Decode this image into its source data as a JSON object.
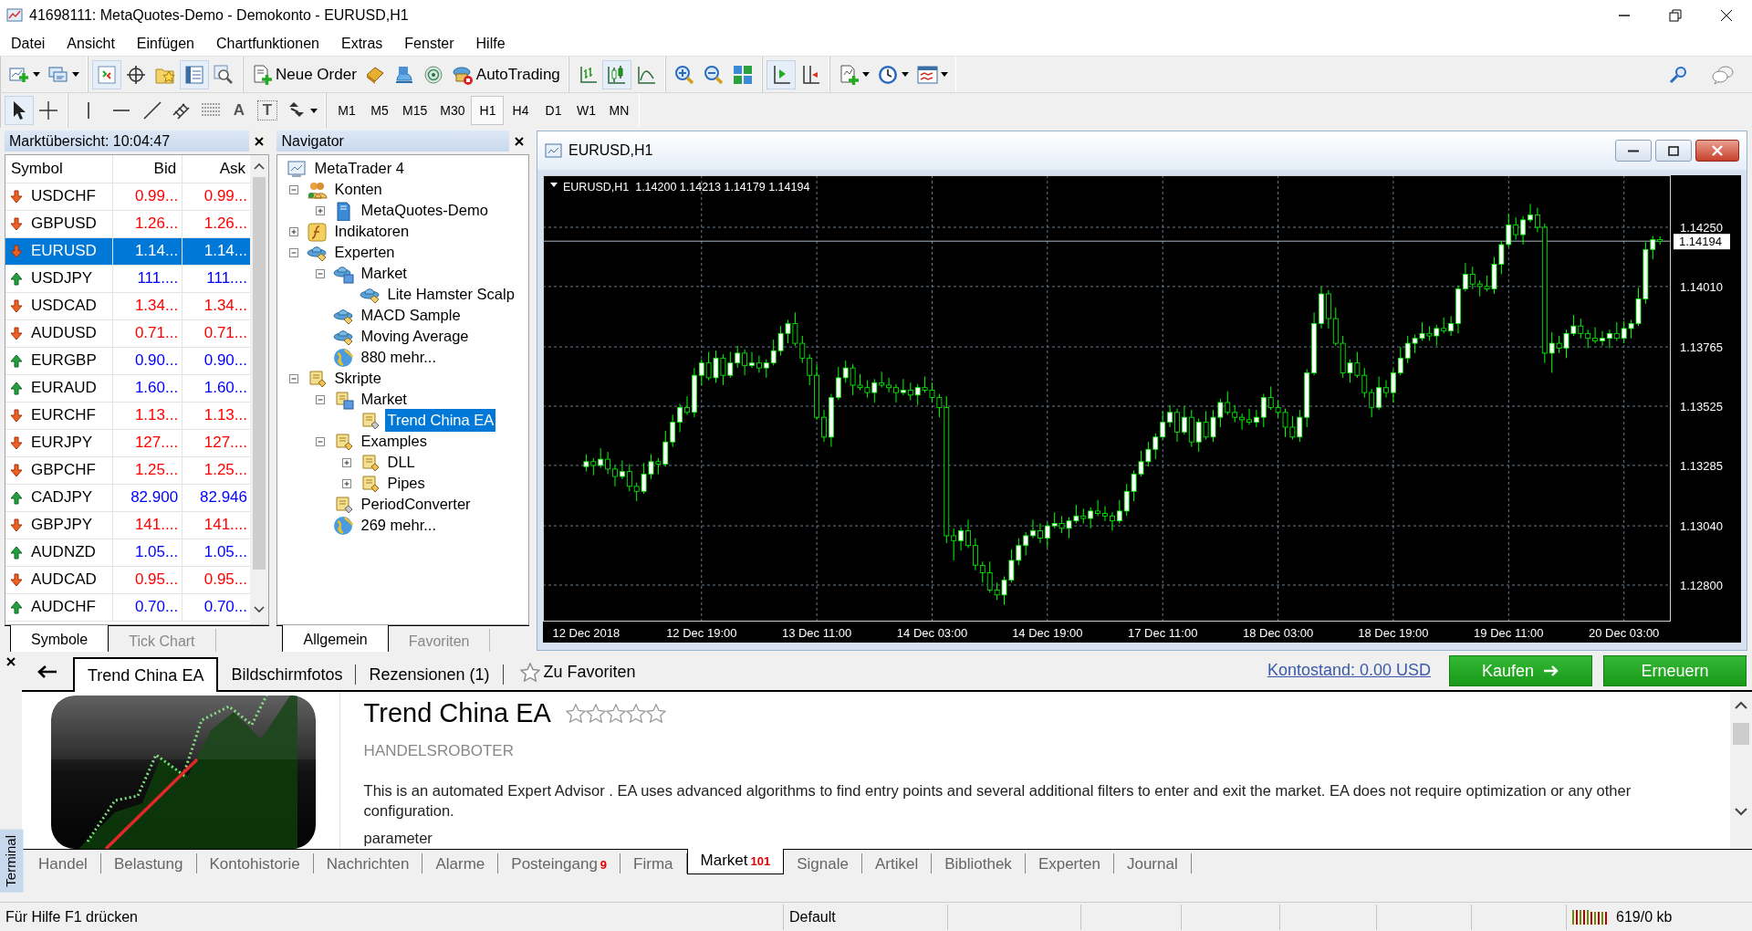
{
  "window": {
    "title": "41698111: MetaQuotes-Demo - Demokonto - EURUSD,H1"
  },
  "menu": [
    "Datei",
    "Ansicht",
    "Einfügen",
    "Chartfunktionen",
    "Extras",
    "Fenster",
    "Hilfe"
  ],
  "toolbar": {
    "new_order": "Neue Order",
    "autotrading": "AutoTrading",
    "text_tool": "A",
    "label_tool": "T"
  },
  "timeframes": [
    {
      "label": "M1",
      "selected": false
    },
    {
      "label": "M5",
      "selected": false
    },
    {
      "label": "M15",
      "selected": false
    },
    {
      "label": "M30",
      "selected": false
    },
    {
      "label": "H1",
      "selected": true
    },
    {
      "label": "H4",
      "selected": false
    },
    {
      "label": "D1",
      "selected": false
    },
    {
      "label": "W1",
      "selected": false
    },
    {
      "label": "MN",
      "selected": false
    }
  ],
  "market_watch": {
    "title": "Marktübersicht: 10:04:47",
    "columns": [
      "Symbol",
      "Bid",
      "Ask"
    ],
    "rows": [
      {
        "symbol": "USDCHF",
        "bid": "0.99...",
        "ask": "0.99...",
        "kind": "down",
        "selected": false
      },
      {
        "symbol": "GBPUSD",
        "bid": "1.26...",
        "ask": "1.26...",
        "kind": "down",
        "selected": false
      },
      {
        "symbol": "EURUSD",
        "bid": "1.14...",
        "ask": "1.14...",
        "kind": "down",
        "selected": true
      },
      {
        "symbol": "USDJPY",
        "bid": "111....",
        "ask": "111....",
        "kind": "up",
        "selected": false
      },
      {
        "symbol": "USDCAD",
        "bid": "1.34...",
        "ask": "1.34...",
        "kind": "down",
        "selected": false
      },
      {
        "symbol": "AUDUSD",
        "bid": "0.71...",
        "ask": "0.71...",
        "kind": "down",
        "selected": false
      },
      {
        "symbol": "EURGBP",
        "bid": "0.90...",
        "ask": "0.90...",
        "kind": "up",
        "selected": false
      },
      {
        "symbol": "EURAUD",
        "bid": "1.60...",
        "ask": "1.60...",
        "kind": "up",
        "selected": false
      },
      {
        "symbol": "EURCHF",
        "bid": "1.13...",
        "ask": "1.13...",
        "kind": "down",
        "selected": false
      },
      {
        "symbol": "EURJPY",
        "bid": "127....",
        "ask": "127....",
        "kind": "down",
        "selected": false
      },
      {
        "symbol": "GBPCHF",
        "bid": "1.25...",
        "ask": "1.25...",
        "kind": "down",
        "selected": false
      },
      {
        "symbol": "CADJPY",
        "bid": "82.900",
        "ask": "82.946",
        "kind": "up",
        "selected": false
      },
      {
        "symbol": "GBPJPY",
        "bid": "141....",
        "ask": "141....",
        "kind": "down",
        "selected": false
      },
      {
        "symbol": "AUDNZD",
        "bid": "1.05...",
        "ask": "1.05...",
        "kind": "up",
        "selected": false
      },
      {
        "symbol": "AUDCAD",
        "bid": "0.95...",
        "ask": "0.95...",
        "kind": "down",
        "selected": false
      },
      {
        "symbol": "AUDCHF",
        "bid": "0.70...",
        "ask": "0.70...",
        "kind": "up",
        "selected": false
      }
    ],
    "tabs": [
      {
        "label": "Symbole",
        "selected": true
      },
      {
        "label": "Tick Chart",
        "selected": false
      }
    ]
  },
  "navigator": {
    "title": "Navigator",
    "tree": [
      {
        "label": "MetaTrader 4",
        "kind": "root",
        "selected": false,
        "children": [
          {
            "label": "Konten",
            "kind": "accounts",
            "expanded": true,
            "selected": false,
            "children": [
              {
                "label": "MetaQuotes-Demo",
                "kind": "server",
                "expanded": false,
                "selected": false
              }
            ]
          },
          {
            "label": "Indikatoren",
            "kind": "indicators",
            "expanded": false,
            "selected": false
          },
          {
            "label": "Experten",
            "kind": "experts",
            "expanded": true,
            "selected": false,
            "children": [
              {
                "label": "Market",
                "kind": "market-experts",
                "expanded": true,
                "selected": false,
                "children": [
                  {
                    "label": "Lite Hamster Scalp",
                    "kind": "expert",
                    "selected": false
                  }
                ]
              },
              {
                "label": "MACD Sample",
                "kind": "expert",
                "selected": false
              },
              {
                "label": "Moving Average",
                "kind": "expert",
                "selected": false
              },
              {
                "label": "880 mehr...",
                "kind": "more",
                "selected": false
              }
            ]
          },
          {
            "label": "Skripte",
            "kind": "scripts",
            "expanded": true,
            "selected": false,
            "children": [
              {
                "label": "Market",
                "kind": "market-scripts",
                "expanded": true,
                "selected": false,
                "children": [
                  {
                    "label": "Trend China EA",
                    "kind": "script",
                    "selected": true
                  }
                ]
              },
              {
                "label": "Examples",
                "kind": "scripts",
                "expanded": true,
                "selected": false,
                "children": [
                  {
                    "label": "DLL",
                    "kind": "scripts",
                    "expanded": false,
                    "selected": false
                  },
                  {
                    "label": "Pipes",
                    "kind": "scripts",
                    "expanded": false,
                    "selected": false
                  }
                ]
              },
              {
                "label": "PeriodConverter",
                "kind": "script",
                "selected": false
              },
              {
                "label": "269 mehr...",
                "kind": "more",
                "selected": false
              }
            ]
          }
        ]
      }
    ],
    "tabs": [
      {
        "label": "Allgemein",
        "selected": true
      },
      {
        "label": "Favoriten",
        "selected": false
      }
    ]
  },
  "chart": {
    "title": "EURUSD,H1",
    "info": "EURUSD,H1  1.14200 1.14213 1.14179 1.14194",
    "chart_data": {
      "type": "candlestick",
      "categories": [
        "12 Dec 2018",
        null,
        null,
        null,
        null,
        null,
        null,
        null,
        null,
        null,
        null,
        null,
        null,
        null,
        null,
        null,
        "12 Dec 19:00",
        null,
        null,
        null,
        null,
        null,
        null,
        null,
        null,
        null,
        null,
        null,
        null,
        null,
        null,
        null,
        "13 Dec 11:00",
        null,
        null,
        null,
        null,
        null,
        null,
        null,
        null,
        null,
        null,
        null,
        null,
        null,
        null,
        null,
        "14 Dec 03:00",
        null,
        null,
        null,
        null,
        null,
        null,
        null,
        null,
        null,
        null,
        null,
        null,
        null,
        null,
        null,
        "14 Dec 19:00",
        null,
        null,
        null,
        null,
        null,
        null,
        null,
        null,
        null,
        null,
        null,
        null,
        null,
        null,
        null,
        "17 Dec 11:00",
        null,
        null,
        null,
        null,
        null,
        null,
        null,
        null,
        null,
        null,
        null,
        null,
        null,
        null,
        null,
        "18 Dec 03:00",
        null,
        null,
        null,
        null,
        null,
        null,
        null,
        null,
        null,
        null,
        null,
        null,
        null,
        null,
        null,
        "18 Dec 19:00",
        null,
        null,
        null,
        null,
        null,
        null,
        null,
        null,
        null,
        null,
        null,
        null,
        null,
        null,
        null,
        "19 Dec 11:00",
        null,
        null,
        null,
        null,
        null,
        null,
        null,
        null,
        null,
        null,
        null,
        null,
        null,
        null,
        null,
        "20 Dec 03:00",
        null,
        null,
        null,
        null,
        null
      ],
      "ylim": [
        1.12652,
        1.14461
      ],
      "grid": true,
      "ref_lines": [
        {
          "axis": "y",
          "value": 1.14194,
          "label": "1.14194"
        }
      ],
      "ohlc": [
        [
          1.1328,
          1.1333,
          1.1326,
          1.133
        ],
        [
          1.133,
          1.13315,
          1.13245,
          1.13285
        ],
        [
          1.13285,
          1.13355,
          1.13275,
          1.1331
        ],
        [
          1.1331,
          1.1334,
          1.1325,
          1.1327
        ],
        [
          1.1327,
          1.13285,
          1.132,
          1.1324
        ],
        [
          1.1324,
          1.13305,
          1.1323,
          1.1326
        ],
        [
          1.1326,
          1.1329,
          1.1318,
          1.132
        ],
        [
          1.132,
          1.13215,
          1.1314,
          1.1318
        ],
        [
          1.1318,
          1.13295,
          1.1317,
          1.1325
        ],
        [
          1.1325,
          1.1333,
          1.1323,
          1.133
        ],
        [
          1.133,
          1.13315,
          1.1325,
          1.1329
        ],
        [
          1.1329,
          1.13425,
          1.1328,
          1.1338
        ],
        [
          1.1338,
          1.1349,
          1.1336,
          1.1346
        ],
        [
          1.1346,
          1.13535,
          1.1342,
          1.1352
        ],
        [
          1.1352,
          1.13565,
          1.1349,
          1.135
        ],
        [
          1.135,
          1.1368,
          1.1348,
          1.1365
        ],
        [
          1.1365,
          1.13715,
          1.1361,
          1.137
        ],
        [
          1.137,
          1.13745,
          1.1363,
          1.1364
        ],
        [
          1.1364,
          1.1375,
          1.1362,
          1.1372
        ],
        [
          1.1372,
          1.13735,
          1.1361,
          1.1365
        ],
        [
          1.1365,
          1.13745,
          1.1364,
          1.137
        ],
        [
          1.137,
          1.1377,
          1.1368,
          1.1374
        ],
        [
          1.1374,
          1.13755,
          1.1365,
          1.1369
        ],
        [
          1.1369,
          1.13745,
          1.1368,
          1.137
        ],
        [
          1.137,
          1.1373,
          1.1366,
          1.1368
        ],
        [
          1.1368,
          1.13715,
          1.1364,
          1.137
        ],
        [
          1.137,
          1.13795,
          1.1369,
          1.1375
        ],
        [
          1.1375,
          1.1385,
          1.1373,
          1.1382
        ],
        [
          1.1382,
          1.13875,
          1.1378,
          1.1386
        ],
        [
          1.1386,
          1.13905,
          1.1377,
          1.1378
        ],
        [
          1.1378,
          1.1381,
          1.137,
          1.1372
        ],
        [
          1.1372,
          1.13735,
          1.1361,
          1.1365
        ],
        [
          1.1365,
          1.13695,
          1.1347,
          1.1348
        ],
        [
          1.1348,
          1.1351,
          1.1338,
          1.134
        ],
        [
          1.134,
          1.13575,
          1.1336,
          1.1356
        ],
        [
          1.1356,
          1.13685,
          1.1355,
          1.1364
        ],
        [
          1.1364,
          1.1371,
          1.1362,
          1.1368
        ],
        [
          1.1368,
          1.13695,
          1.1357,
          1.1361
        ],
        [
          1.1361,
          1.13655,
          1.1359,
          1.136
        ],
        [
          1.136,
          1.1363,
          1.1356,
          1.1358
        ],
        [
          1.1358,
          1.13635,
          1.1354,
          1.1362
        ],
        [
          1.1362,
          1.13665,
          1.136,
          1.1361
        ],
        [
          1.1361,
          1.1364,
          1.1358,
          1.136
        ],
        [
          1.136,
          1.13615,
          1.1354,
          1.1358
        ],
        [
          1.1358,
          1.13635,
          1.1357,
          1.1359
        ],
        [
          1.1359,
          1.1362,
          1.1355,
          1.1357
        ],
        [
          1.1357,
          1.13615,
          1.1353,
          1.136
        ],
        [
          1.136,
          1.13645,
          1.1358,
          1.1359
        ],
        [
          1.1359,
          1.1362,
          1.1354,
          1.1356
        ],
        [
          1.1356,
          1.13575,
          1.1348,
          1.1352
        ],
        [
          1.1352,
          1.13565,
          1.1297,
          1.13
        ],
        [
          1.13,
          1.1303,
          1.129,
          1.1298
        ],
        [
          1.1298,
          1.13035,
          1.1294,
          1.1302
        ],
        [
          1.1302,
          1.13065,
          1.1295,
          1.1296
        ],
        [
          1.1296,
          1.1299,
          1.1286,
          1.1288
        ],
        [
          1.1288,
          1.12895,
          1.1281,
          1.1285
        ],
        [
          1.1285,
          1.12895,
          1.1277,
          1.1278
        ],
        [
          1.1278,
          1.1281,
          1.1274,
          1.1276
        ],
        [
          1.1276,
          1.12835,
          1.1272,
          1.1282
        ],
        [
          1.1282,
          1.12945,
          1.1281,
          1.129
        ],
        [
          1.129,
          1.1299,
          1.1288,
          1.1296
        ],
        [
          1.1296,
          1.13015,
          1.1292,
          1.13
        ],
        [
          1.13,
          1.13065,
          1.1299,
          1.1302
        ],
        [
          1.1302,
          1.1305,
          1.1297,
          1.1299
        ],
        [
          1.1299,
          1.13055,
          1.1295,
          1.1304
        ],
        [
          1.1304,
          1.13095,
          1.1303,
          1.1305
        ],
        [
          1.1305,
          1.1308,
          1.1301,
          1.1303
        ],
        [
          1.1303,
          1.13075,
          1.1299,
          1.1306
        ],
        [
          1.1306,
          1.13125,
          1.1305,
          1.1308
        ],
        [
          1.1308,
          1.1311,
          1.1305,
          1.1307
        ],
        [
          1.1307,
          1.13115,
          1.1303,
          1.131
        ],
        [
          1.131,
          1.13145,
          1.1308,
          1.1309
        ],
        [
          1.1309,
          1.1312,
          1.1306,
          1.1308
        ],
        [
          1.1308,
          1.13095,
          1.1302,
          1.1306
        ],
        [
          1.1306,
          1.13145,
          1.1305,
          1.131
        ],
        [
          1.131,
          1.1321,
          1.1308,
          1.1318
        ],
        [
          1.1318,
          1.13265,
          1.1314,
          1.1325
        ],
        [
          1.1325,
          1.13345,
          1.1324,
          1.133
        ],
        [
          1.133,
          1.1338,
          1.1328,
          1.1335
        ],
        [
          1.1335,
          1.13415,
          1.1331,
          1.134
        ],
        [
          1.134,
          1.13505,
          1.1339,
          1.1346
        ],
        [
          1.1346,
          1.1353,
          1.1344,
          1.135
        ],
        [
          1.135,
          1.13515,
          1.1338,
          1.1342
        ],
        [
          1.1342,
          1.13525,
          1.1341,
          1.1348
        ],
        [
          1.1348,
          1.1351,
          1.1336,
          1.1338
        ],
        [
          1.1338,
          1.13475,
          1.1334,
          1.1346
        ],
        [
          1.1346,
          1.13505,
          1.1339,
          1.134
        ],
        [
          1.134,
          1.1351,
          1.1338,
          1.1348
        ],
        [
          1.1348,
          1.13555,
          1.1344,
          1.1354
        ],
        [
          1.1354,
          1.13585,
          1.1349,
          1.135
        ],
        [
          1.135,
          1.1353,
          1.1346,
          1.1348
        ],
        [
          1.1348,
          1.13495,
          1.1343,
          1.1347
        ],
        [
          1.1347,
          1.13515,
          1.1345,
          1.1346
        ],
        [
          1.1346,
          1.1351,
          1.1344,
          1.1348
        ],
        [
          1.1348,
          1.13575,
          1.1344,
          1.1356
        ],
        [
          1.1356,
          1.13605,
          1.1351,
          1.1352
        ],
        [
          1.1352,
          1.1355,
          1.1348,
          1.135
        ],
        [
          1.135,
          1.13515,
          1.134,
          1.1344
        ],
        [
          1.1344,
          1.13485,
          1.1339,
          1.134
        ],
        [
          1.134,
          1.1351,
          1.1338,
          1.1348
        ],
        [
          1.1348,
          1.13675,
          1.1344,
          1.1366
        ],
        [
          1.1366,
          1.13905,
          1.1365,
          1.1386
        ],
        [
          1.1386,
          1.1401,
          1.1384,
          1.1398
        ],
        [
          1.1398,
          1.13995,
          1.1384,
          1.1388
        ],
        [
          1.1388,
          1.13925,
          1.1377,
          1.1378
        ],
        [
          1.1378,
          1.1381,
          1.1364,
          1.1366
        ],
        [
          1.1366,
          1.13715,
          1.1362,
          1.137
        ],
        [
          1.137,
          1.13745,
          1.1364,
          1.1365
        ],
        [
          1.1365,
          1.1368,
          1.1356,
          1.1358
        ],
        [
          1.1358,
          1.13595,
          1.1348,
          1.1352
        ],
        [
          1.1352,
          1.13645,
          1.1351,
          1.136
        ],
        [
          1.136,
          1.1363,
          1.1356,
          1.1358
        ],
        [
          1.1358,
          1.13675,
          1.1354,
          1.1366
        ],
        [
          1.1366,
          1.13765,
          1.1365,
          1.1372
        ],
        [
          1.1372,
          1.1381,
          1.137,
          1.1378
        ],
        [
          1.1378,
          1.13815,
          1.1374,
          1.138
        ],
        [
          1.138,
          1.13865,
          1.1379,
          1.1382
        ],
        [
          1.1382,
          1.1385,
          1.1379,
          1.1381
        ],
        [
          1.1381,
          1.13855,
          1.1377,
          1.1384
        ],
        [
          1.1384,
          1.13885,
          1.1382,
          1.1383
        ],
        [
          1.1383,
          1.1389,
          1.1381,
          1.1386
        ],
        [
          1.1386,
          1.14015,
          1.1382,
          1.14
        ],
        [
          1.14,
          1.14105,
          1.1399,
          1.1406
        ],
        [
          1.1406,
          1.1409,
          1.14,
          1.1402
        ],
        [
          1.1402,
          1.14035,
          1.1397,
          1.1401
        ],
        [
          1.1401,
          1.14055,
          1.1399,
          1.14
        ],
        [
          1.14,
          1.1413,
          1.1398,
          1.141
        ],
        [
          1.141,
          1.14195,
          1.1406,
          1.1418
        ],
        [
          1.1418,
          1.14305,
          1.1417,
          1.1426
        ],
        [
          1.1426,
          1.1429,
          1.142,
          1.1422
        ],
        [
          1.1422,
          1.14295,
          1.1418,
          1.1428
        ],
        [
          1.1428,
          1.14345,
          1.1427,
          1.143
        ],
        [
          1.143,
          1.1433,
          1.1423,
          1.1425
        ],
        [
          1.1425,
          1.14265,
          1.137,
          1.1374
        ],
        [
          1.1374,
          1.13825,
          1.1366,
          1.1378
        ],
        [
          1.1378,
          1.1381,
          1.1374,
          1.1376
        ],
        [
          1.1376,
          1.13835,
          1.1372,
          1.1382
        ],
        [
          1.1382,
          1.13895,
          1.1381,
          1.1385
        ],
        [
          1.1385,
          1.1388,
          1.138,
          1.1382
        ],
        [
          1.1382,
          1.13835,
          1.1376,
          1.138
        ],
        [
          1.138,
          1.13845,
          1.1378,
          1.1379
        ],
        [
          1.1379,
          1.1383,
          1.1377,
          1.138
        ],
        [
          1.138,
          1.13835,
          1.1376,
          1.1382
        ],
        [
          1.1382,
          1.13865,
          1.1379,
          1.138
        ],
        [
          1.138,
          1.1387,
          1.1378,
          1.1384
        ],
        [
          1.1384,
          1.13875,
          1.138,
          1.1386
        ],
        [
          1.1386,
          1.14005,
          1.1385,
          1.1396
        ],
        [
          1.1396,
          1.1419,
          1.1394,
          1.1416
        ],
        [
          1.1416,
          1.14215,
          1.1412,
          1.142
        ],
        [
          1.142,
          1.14213,
          1.14179,
          1.14194
        ]
      ],
      "yticks": [
        {
          "value": 1.1425,
          "label": "1.14250"
        },
        {
          "value": 1.1401,
          "label": "1.14010"
        },
        {
          "value": 1.13765,
          "label": "1.13765"
        },
        {
          "value": 1.13525,
          "label": "1.13525"
        },
        {
          "value": 1.13285,
          "label": "1.13285"
        },
        {
          "value": 1.1304,
          "label": "1.13040"
        },
        {
          "value": 1.128,
          "label": "1.12800"
        }
      ]
    }
  },
  "terminal": {
    "label": "Terminal",
    "tabs": [
      {
        "label": "Trend China EA",
        "selected": true
      },
      {
        "label": "Bildschirmfotos",
        "selected": false
      },
      {
        "label": "Rezensionen (1)",
        "selected": false
      }
    ],
    "favorite": "Zu Favoriten",
    "balance": "Kontostand: 0.00 USD",
    "buy": "Kaufen",
    "renew": "Erneuern",
    "product": {
      "title": "Trend China EA",
      "stars": 0,
      "category": "HANDELSROBOTER",
      "description": "This is an automated Expert Advisor . EA uses advanced algorithms to find entry points and several additional filters to enter and exit the market. EA does not require optimization or any other configuration.",
      "more": "parameter"
    },
    "bottom_tabs": [
      {
        "label": "Handel",
        "selected": false
      },
      {
        "label": "Belastung",
        "selected": false
      },
      {
        "label": "Kontohistorie",
        "selected": false
      },
      {
        "label": "Nachrichten",
        "selected": false
      },
      {
        "label": "Alarme",
        "selected": false
      },
      {
        "label": "Posteingang",
        "count": "9",
        "selected": false
      },
      {
        "label": "Firma",
        "selected": false
      },
      {
        "label": "Market",
        "count": "101",
        "selected": true
      },
      {
        "label": "Signale",
        "selected": false
      },
      {
        "label": "Artikel",
        "selected": false
      },
      {
        "label": "Bibliothek",
        "selected": false
      },
      {
        "label": "Experten",
        "selected": false
      },
      {
        "label": "Journal",
        "selected": false
      }
    ]
  },
  "status_bar": {
    "help": "Für Hilfe F1 drücken",
    "profile": "Default",
    "traffic": "619/0 kb"
  }
}
